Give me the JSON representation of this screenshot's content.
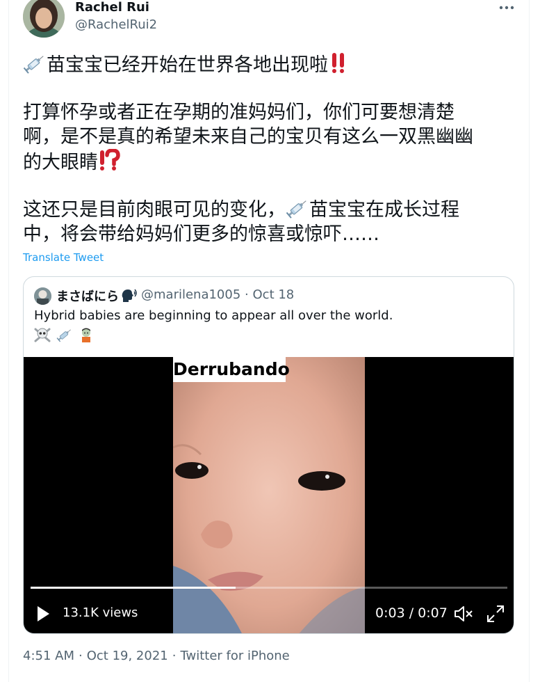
{
  "author": {
    "name": "Rachel Rui",
    "handle": "@RachelRui2"
  },
  "tweet": {
    "lines": [
      "苗宝宝已经开始在世界各地出现啦",
      "打算怀孕或者正在孕期的准妈妈们，你们可要想清楚",
      "啊，是不是真的希望未来自己的宝贝有这么一双黑幽幽",
      "的大眼睛",
      "这还只是目前肉眼可见的变化，",
      "苗宝宝在成长过程",
      "中，将会带给妈妈们更多的惊喜或惊吓……"
    ],
    "translate_label": "Translate Tweet"
  },
  "quoted": {
    "name": "まさばにら",
    "handle": "@marilena1005",
    "separator": "·",
    "date": "Oct 18",
    "text": "Hybrid babies are beginning to appear all over the world."
  },
  "video": {
    "caption": "Derrubando",
    "views": "13.1K views",
    "time": "0:03 / 0:07",
    "progress": 0.43
  },
  "footer": {
    "time": "4:51 AM",
    "date": "Oct 19, 2021",
    "source": "Twitter for iPhone",
    "sep": "·"
  },
  "colors": {
    "text": "#0f1419",
    "muted": "#536471",
    "link": "#1d9bf0",
    "border": "#cfd9de",
    "accent_red": "#d0202e"
  },
  "icons": [
    "syringe-icon",
    "double-exclamation-icon",
    "exclamation-question-icon",
    "more-icon",
    "speaking-head-icon",
    "skull-crossbones-icon",
    "zombie-icon",
    "play-icon",
    "mute-icon",
    "fullscreen-icon"
  ]
}
